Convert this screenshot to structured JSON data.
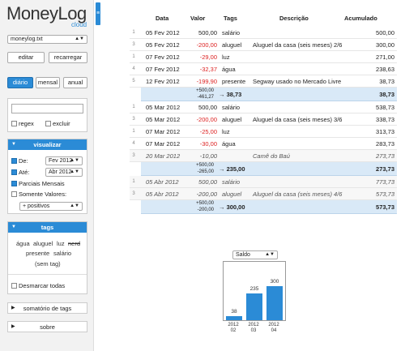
{
  "app": {
    "title": "MoneyLog",
    "subtitle": "cloud"
  },
  "sidebar": {
    "file_select": "moneylog.txt",
    "edit_label": "editar",
    "reload_label": "recarregar",
    "views": [
      "diário",
      "mensal",
      "anual"
    ],
    "filter": {
      "regex_label": "regex",
      "exclude_label": "excluir",
      "value": ""
    },
    "visualizar": {
      "title": "visualizar",
      "from_label": "De:",
      "from_value": "Fev 2012",
      "to_label": "Até:",
      "to_value": "Abr 2012",
      "partial_label": "Parciais Mensais",
      "only_values_label": "Somente Valores:",
      "values_select": "+ positivos"
    },
    "tags": {
      "title": "tags",
      "words": [
        "água",
        "aluguel",
        "luz",
        "nerd",
        "presente",
        "salário",
        "(sem tag)"
      ],
      "uncheck_all": "Desmarcar todas"
    },
    "sum_tags_label": "somatório de tags",
    "about_label": "sobre"
  },
  "table": {
    "headers": [
      "Data",
      "Valor",
      "Tags",
      "Descrição",
      "Acumulado"
    ],
    "rows": [
      {
        "n": "1",
        "date": "05 Fev 2012",
        "value": "500,00",
        "neg": false,
        "tags": "salário",
        "desc": "",
        "acc": "500,00",
        "future": false
      },
      {
        "n": "3",
        "date": "05 Fev 2012",
        "value": "-200,00",
        "neg": true,
        "tags": "aluguel",
        "desc": "Aluguel da casa (seis meses) 2/6",
        "acc": "300,00",
        "future": false
      },
      {
        "n": "1",
        "date": "07 Fev 2012",
        "value": "-29,00",
        "neg": true,
        "tags": "luz",
        "desc": "",
        "acc": "271,00",
        "future": false
      },
      {
        "n": "4",
        "date": "07 Fev 2012",
        "value": "-32,37",
        "neg": true,
        "tags": "água",
        "desc": "",
        "acc": "238,63",
        "future": false
      },
      {
        "n": "5",
        "date": "12 Fev 2012",
        "value": "-199,90",
        "neg": true,
        "tags": "presente",
        "desc": "Segway usado no Mercado Livre",
        "acc": "38,73",
        "future": false
      },
      {
        "sum": true,
        "pos": "+500,00",
        "negsum": "-461,27",
        "total": "38,73",
        "acc": "38,73"
      },
      {
        "n": "1",
        "date": "05 Mar 2012",
        "value": "500,00",
        "neg": false,
        "tags": "salário",
        "desc": "",
        "acc": "538,73",
        "future": false
      },
      {
        "n": "3",
        "date": "05 Mar 2012",
        "value": "-200,00",
        "neg": true,
        "tags": "aluguel",
        "desc": "Aluguel da casa (seis meses) 3/6",
        "acc": "338,73",
        "future": false
      },
      {
        "n": "1",
        "date": "07 Mar 2012",
        "value": "-25,00",
        "neg": true,
        "tags": "luz",
        "desc": "",
        "acc": "313,73",
        "future": false
      },
      {
        "n": "4",
        "date": "07 Mar 2012",
        "value": "-30,00",
        "neg": true,
        "tags": "água",
        "desc": "",
        "acc": "283,73",
        "future": false
      },
      {
        "n": "3",
        "date": "20 Mar 2012",
        "value": "-10,00",
        "neg": true,
        "tags": "",
        "desc": "Camê do Baú",
        "acc": "273,73",
        "future": true
      },
      {
        "sum": true,
        "pos": "+500,00",
        "negsum": "-265,00",
        "total": "235,00",
        "acc": "273,73"
      },
      {
        "n": "1",
        "date": "05 Abr 2012",
        "value": "500,00",
        "neg": false,
        "tags": "salário",
        "desc": "",
        "acc": "773,73",
        "future": true
      },
      {
        "n": "3",
        "date": "05 Abr 2012",
        "value": "-200,00",
        "neg": true,
        "tags": "aluguel",
        "desc": "Aluguel da casa (seis meses) 4/6",
        "acc": "573,73",
        "future": true
      },
      {
        "sum": true,
        "pos": "+500,00",
        "negsum": "-200,00",
        "total": "300,00",
        "acc": "573,73"
      }
    ]
  },
  "chart_select": "Saldo",
  "chart_data": {
    "type": "bar",
    "categories": [
      "2012 02",
      "2012 03",
      "2012 04"
    ],
    "values": [
      38,
      235,
      300
    ],
    "ylim": [
      0,
      300
    ],
    "color": "#2b8bd6"
  }
}
